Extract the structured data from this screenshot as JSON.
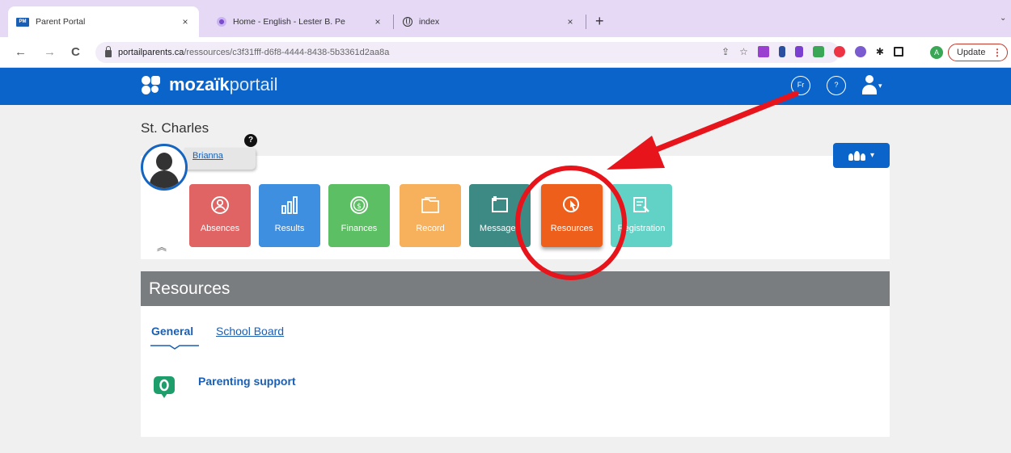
{
  "browser": {
    "tabs": [
      {
        "title": "Parent Portal",
        "favicon": "parent-portal-favicon",
        "active": true
      },
      {
        "title": "Home - English - Lester B. Pe",
        "favicon": "home-favicon",
        "active": false
      },
      {
        "title": "index",
        "favicon": "globe-icon",
        "active": false
      }
    ],
    "close_glyph": "×",
    "new_tab_glyph": "+",
    "overflow_glyph": "⌄",
    "url_host": "portailparents.ca",
    "url_path": "/ressources/c3f31fff-d6f8-4444-8438-5b3361d2aa8a",
    "profile_initial": "A",
    "update_label": "Update",
    "nav": {
      "back": "←",
      "forward": "→",
      "reload": "C"
    }
  },
  "header": {
    "logo_brand": "mozaïk",
    "logo_sub": "portail",
    "lang_label": "Fr",
    "help_label": "?",
    "caret": "▾",
    "color": "#0a64c9"
  },
  "student": {
    "school": "St. Charles",
    "name": "Brianna",
    "help_badge": "?"
  },
  "tiles": [
    {
      "label": "Absences",
      "icon": "person-circle-icon",
      "color": "#e06464"
    },
    {
      "label": "Results",
      "icon": "bar-chart-icon",
      "color": "#3f8fe0"
    },
    {
      "label": "Finances",
      "icon": "dollar-coin-icon",
      "color": "#5cbf63"
    },
    {
      "label": "Record",
      "icon": "folder-icon",
      "color": "#f7b15c"
    },
    {
      "label": "Messages",
      "icon": "message-board-icon",
      "color": "#3d8a85"
    },
    {
      "label": "Resources",
      "icon": "resource-pointer-icon",
      "color": "#ee5f1c"
    },
    {
      "label": "Registration",
      "icon": "registration-form-icon",
      "color": "#62d1c6"
    }
  ],
  "collapse_glyph": "︽",
  "section": {
    "title": "Resources",
    "subtabs": [
      {
        "label": "General",
        "active": true
      },
      {
        "label": "School Board",
        "active": false
      }
    ],
    "resources": [
      {
        "label": "Parenting support",
        "icon": "speech-bubble-icon"
      }
    ]
  },
  "annotation_color": "#e8141b"
}
